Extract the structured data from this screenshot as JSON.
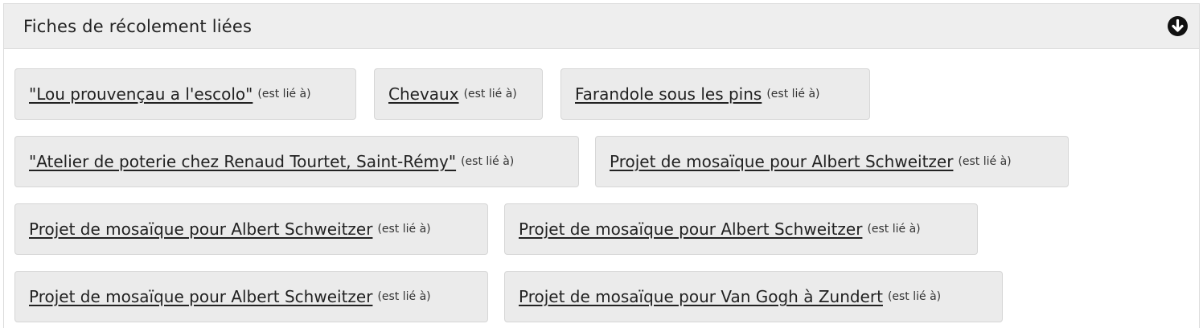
{
  "panel": {
    "title": "Fiches de récolement liées",
    "toggle_icon": "arrow-down-circle-icon"
  },
  "relation_label": "(est lié à)",
  "rows": [
    [
      "\"Lou prouvençau a l'escolo\"",
      "Chevaux",
      "Farandole sous les pins"
    ],
    [
      "\"Atelier de poterie chez Renaud Tourtet, Saint-Rémy\"",
      "Projet de mosaïque pour Albert Schweitzer"
    ],
    [
      "Projet de mosaïque pour Albert Schweitzer",
      "Projet de mosaïque pour Albert Schweitzer"
    ],
    [
      "Projet de mosaïque pour Albert Schweitzer",
      "Projet de mosaïque pour Van Gogh à Zundert"
    ]
  ]
}
